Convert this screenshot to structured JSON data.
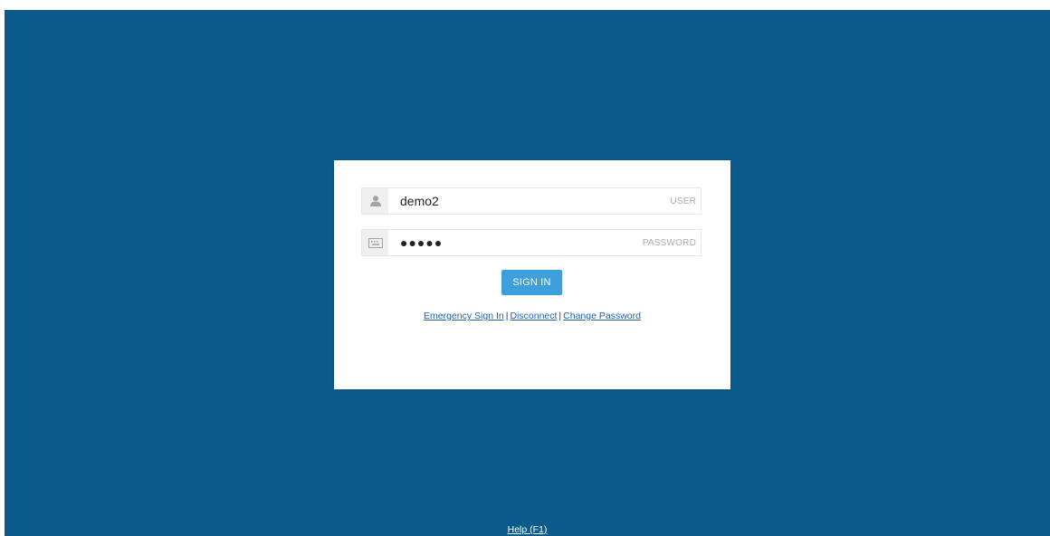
{
  "colors": {
    "background": "#0b5a8c",
    "dialog": "#ffffff",
    "primary_button": "#3d9fdc",
    "link": "#1f5fa8"
  },
  "login": {
    "user_field": {
      "icon": "user-icon",
      "value": "demo2",
      "label": "USER"
    },
    "password_field": {
      "icon": "keyboard-icon",
      "value": "●●●●●",
      "label": "PASSWORD"
    },
    "sign_in_label": "SIGN IN",
    "links": {
      "emergency_sign_in": "Emergency Sign In",
      "disconnect": "Disconnect",
      "change_password": "Change Password",
      "separator": "|"
    }
  },
  "footer": {
    "help_label": "Help (F1)"
  }
}
